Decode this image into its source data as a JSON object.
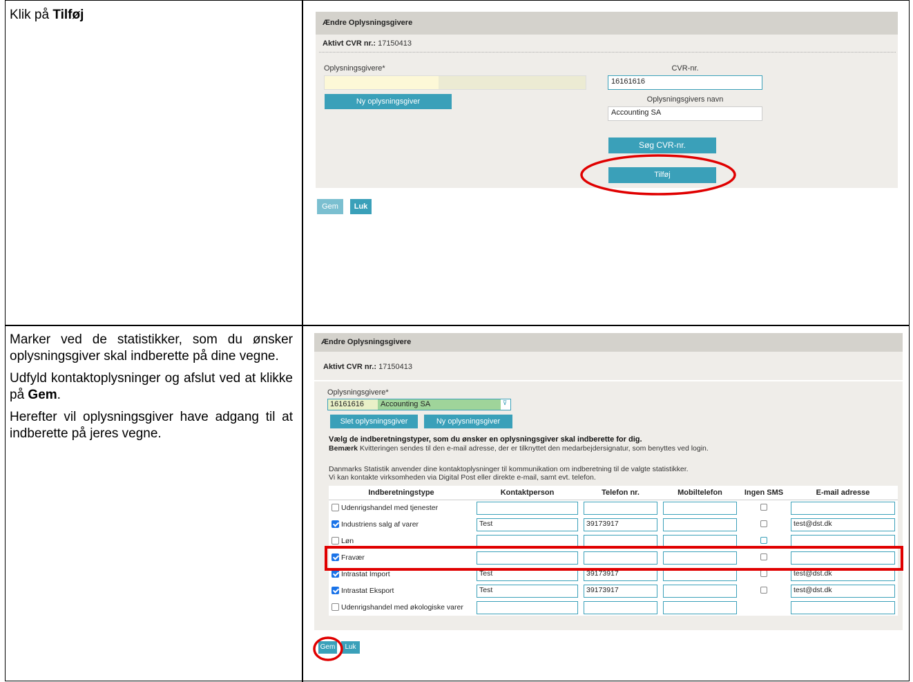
{
  "step1": {
    "instruction_prefix": "Klik på ",
    "instruction_bold": "Tilføj",
    "panel_title": "Ændre Oplysningsgivere",
    "cvr_label": "Aktivt CVR nr.:",
    "cvr_value": "17150413",
    "oplysningsgivere_label": "Oplysningsgivere*",
    "ny_button": "Ny oplysningsgiver",
    "cvr_nr_label": "CVR-nr.",
    "cvr_nr_value": "16161616",
    "navn_label": "Oplysningsgivers navn",
    "navn_value": "Accounting SA",
    "sog_button": "Søg CVR-nr.",
    "tilfoj_button": "Tilføj",
    "gem_button": "Gem",
    "luk_button": "Luk"
  },
  "step2": {
    "instruction_p1": "Marker ved de statistikker, som du ønsker oplysningsgiver skal indberette på dine vegne.",
    "instruction_p2_prefix": "Udfyld kontaktoplysninger og afslut ved at klikke på ",
    "instruction_p2_bold": "Gem",
    "instruction_p2_suffix": ".",
    "instruction_p3": "Herefter vil oplysningsgiver have adgang til at indberette på jeres vegne.",
    "panel_title": "Ændre Oplysningsgivere",
    "cvr_label": "Aktivt CVR nr.:",
    "cvr_value": "17150413",
    "oplysningsgivere_label": "Oplysningsgivere*",
    "select_cvr": "16161616",
    "select_name": "Accounting SA",
    "slet_button": "Slet oplysningsgiver",
    "ny_button": "Ny oplysningsgiver",
    "notice_bold": "Vælg de indberetningstyper, som du ønsker en oplysningsgiver skal indberette for dig.",
    "bemaerk_label": "Bemærk",
    "bemaerk_text": " Kvitteringen sendes til den e-mail adresse, der er tilknyttet den medarbejdersignatur, som benyttes ved login.",
    "info1": "Danmarks Statistik anvender dine kontaktoplysninger til kommunikation om indberetning til de valgte statistikker.",
    "info2": "Vi kan kontakte virksomheden via Digital Post eller direkte e-mail, samt evt. telefon.",
    "headers": [
      "Indberetningstype",
      "Kontaktperson",
      "Telefon nr.",
      "Mobiltelefon",
      "Ingen SMS",
      "E-mail adresse"
    ],
    "rows": [
      {
        "type": "Udenrigshandel med tjenester",
        "checked": false,
        "contact": "",
        "phone": "",
        "mobile": "",
        "email": ""
      },
      {
        "type": "Industriens salg af varer",
        "checked": true,
        "contact": "Test",
        "phone": "39173917",
        "mobile": "",
        "email": "test@dst.dk"
      },
      {
        "type": "Løn",
        "checked": false,
        "contact": "",
        "phone": "",
        "mobile": "",
        "email": ""
      },
      {
        "type": "Fravær",
        "checked": true,
        "contact": "",
        "phone": "",
        "mobile": "",
        "email": ""
      },
      {
        "type": "Intrastat Import",
        "checked": true,
        "contact": "Test",
        "phone": "39173917",
        "mobile": "",
        "email": "test@dst.dk"
      },
      {
        "type": "Intrastat Eksport",
        "checked": true,
        "contact": "Test",
        "phone": "39173917",
        "mobile": "",
        "email": "test@dst.dk"
      },
      {
        "type": "Udenrigshandel med økologiske varer",
        "checked": false,
        "contact": "",
        "phone": "",
        "mobile": "",
        "email": ""
      }
    ],
    "gem_button": "Gem",
    "luk_button": "Luk"
  },
  "colors": {
    "accent": "#3aa0b9",
    "highlight": "#e00000",
    "panel": "#efede9",
    "header": "#d4d2cc"
  }
}
